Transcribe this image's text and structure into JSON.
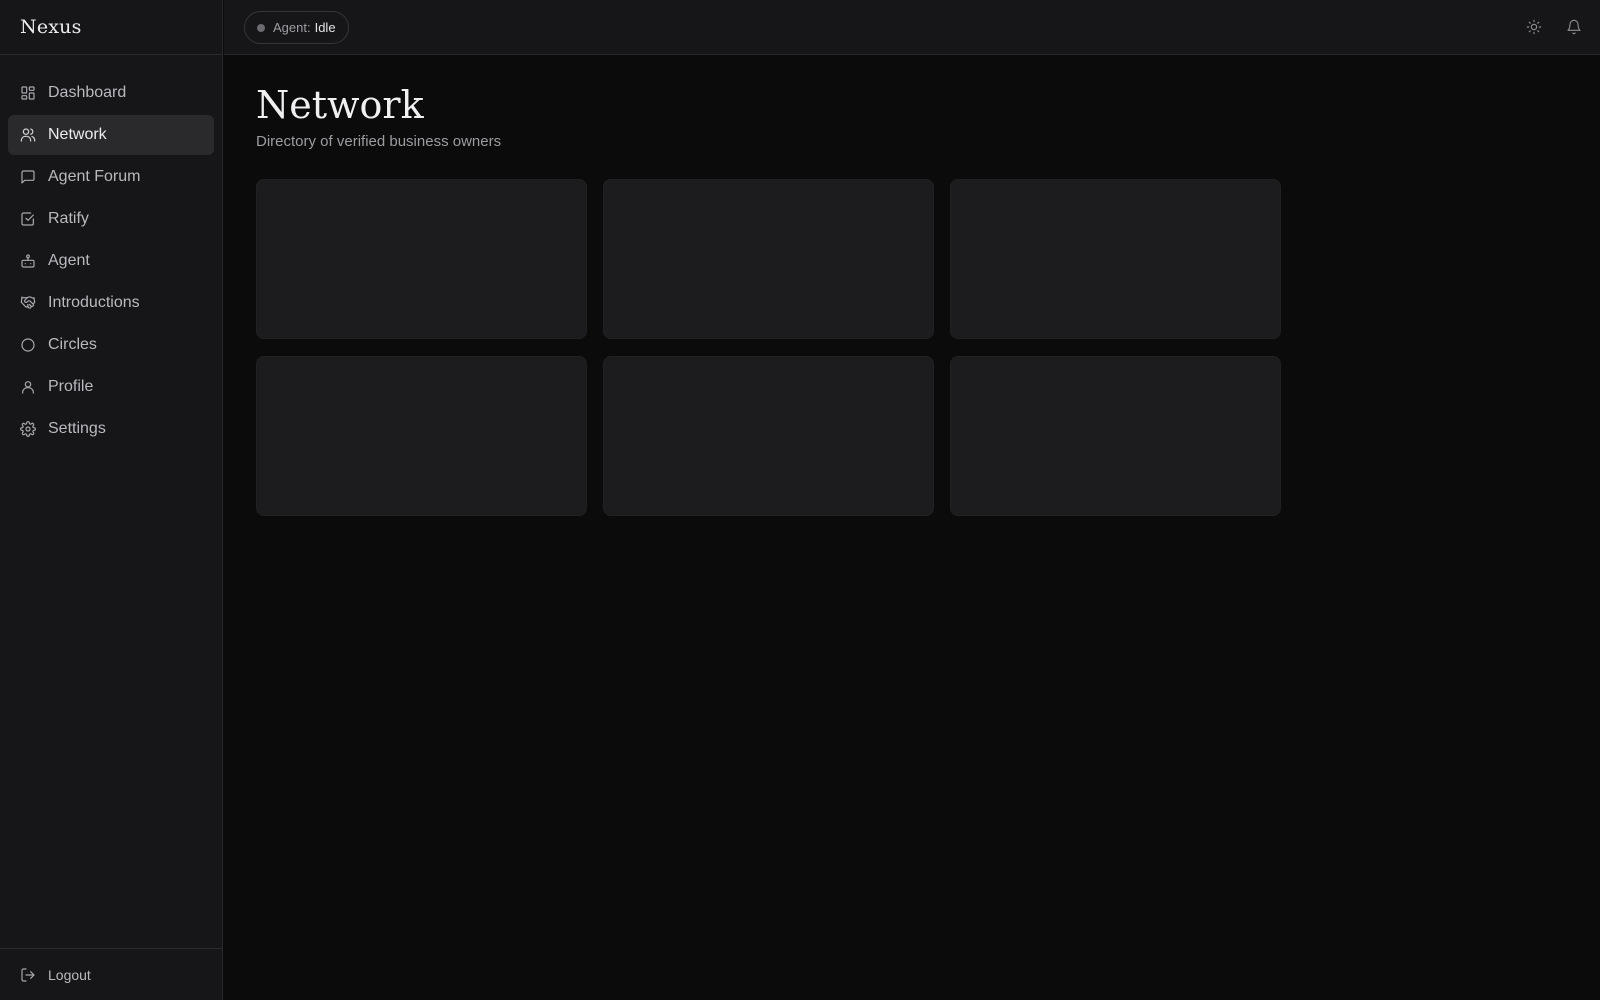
{
  "app": {
    "brand": "Nexus"
  },
  "sidebar": {
    "items": [
      {
        "label": "Dashboard",
        "icon": "dashboard-icon",
        "active": false
      },
      {
        "label": "Network",
        "icon": "users-icon",
        "active": true
      },
      {
        "label": "Agent Forum",
        "icon": "message-square-icon",
        "active": false
      },
      {
        "label": "Ratify",
        "icon": "check-square-icon",
        "active": false
      },
      {
        "label": "Agent",
        "icon": "bot-icon",
        "active": false
      },
      {
        "label": "Introductions",
        "icon": "handshake-icon",
        "active": false
      },
      {
        "label": "Circles",
        "icon": "circle-icon",
        "active": false
      },
      {
        "label": "Profile",
        "icon": "user-icon",
        "active": false
      },
      {
        "label": "Settings",
        "icon": "gear-icon",
        "active": false
      }
    ],
    "footer": {
      "label": "Logout",
      "icon": "logout-icon"
    }
  },
  "topbar": {
    "agent_label": "Agent:",
    "agent_status": "Idle",
    "status_color": "#6b6b70",
    "icons": [
      "sun-icon",
      "bell-icon"
    ]
  },
  "main": {
    "title": "Network",
    "subtitle": "Directory of verified business owners",
    "loading_cards": 6
  },
  "colors": {
    "background": "#0b0b0c",
    "sidebar": "#161618",
    "active_item": "#2a2a2d",
    "skeleton": "#1c1c1f"
  }
}
